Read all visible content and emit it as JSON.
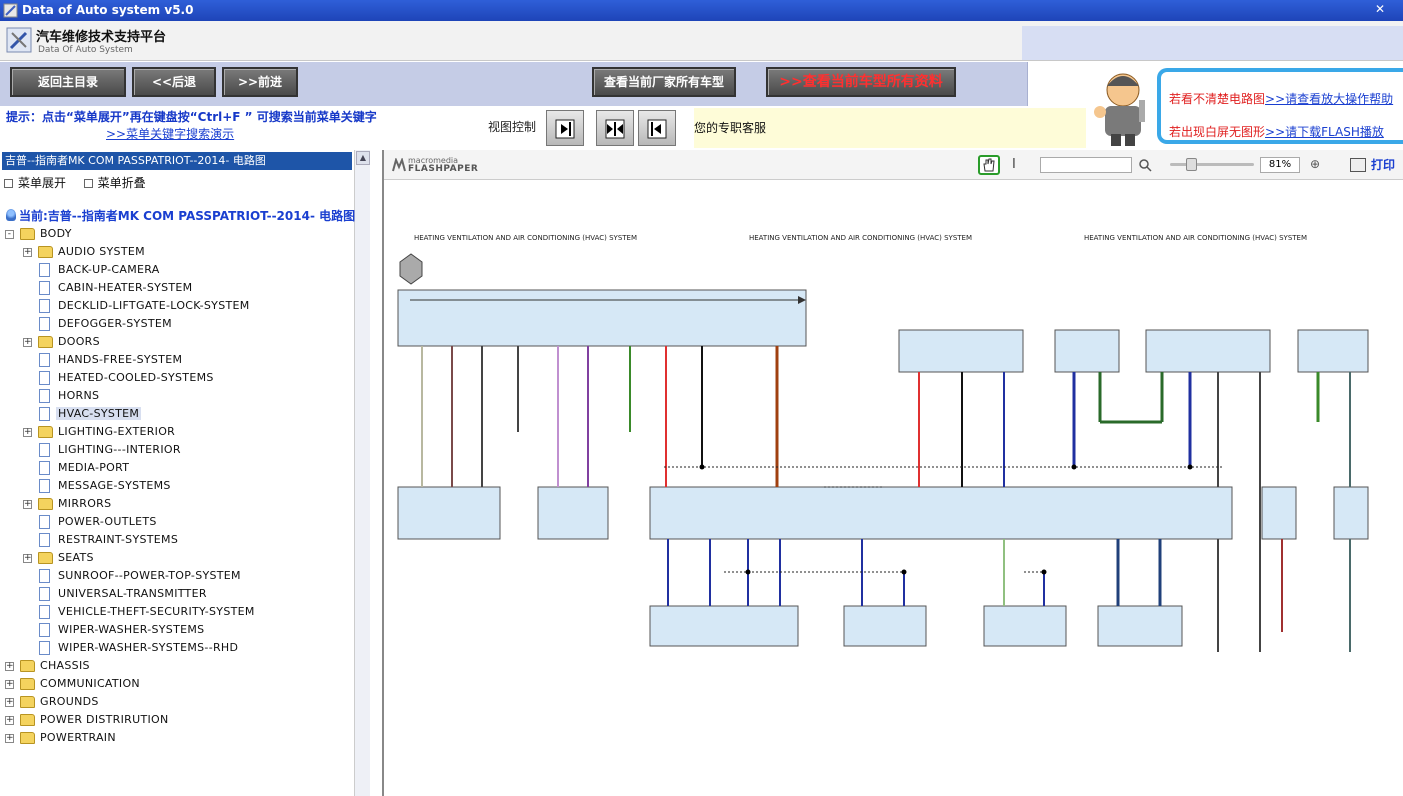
{
  "window": {
    "title": "Data of Auto system v5.0"
  },
  "header": {
    "title_cn": "汽车维修技术支持平台",
    "title_en": "Data Of Auto System"
  },
  "toolbar": {
    "home": "返回主目录",
    "back": "<<后退",
    "forward": ">>前进",
    "maker_models": "查看当前厂家所有车型",
    "all_data": ">>查看当前车型所有资料"
  },
  "promo": {
    "line1_red": "若看不清楚电路图",
    "line1_link": ">>请查看放大操作帮助",
    "line2_red": "若出现白屏无图形",
    "line2_link": ">>请下载FLASH播放"
  },
  "hint": {
    "text": "提示：点击“菜单展开”再在键盘按“Ctrl+F ” 可搜索当前菜单关键字",
    "link": ">>菜单关键字搜索演示"
  },
  "view_control": {
    "label": "视图控制"
  },
  "service": {
    "text": "您的专职客服"
  },
  "left": {
    "title": "吉普--指南者MK COM PASSPATRIOT--2014- 电路图",
    "expand": "菜单展开",
    "collapse": "菜单折叠",
    "current": "当前:吉普--指南者MK COM PASSPATRIOT--2014- 电路图"
  },
  "tree": [
    {
      "label": "BODY",
      "type": "folder",
      "level": 0,
      "toggle": "-"
    },
    {
      "label": "AUDIO SYSTEM",
      "type": "folder",
      "level": 1,
      "toggle": "+"
    },
    {
      "label": "BACK-UP-CAMERA",
      "type": "doc",
      "level": 1
    },
    {
      "label": "CABIN-HEATER-SYSTEM",
      "type": "doc",
      "level": 1
    },
    {
      "label": "DECKLID-LIFTGATE-LOCK-SYSTEM",
      "type": "doc",
      "level": 1
    },
    {
      "label": "DEFOGGER-SYSTEM",
      "type": "doc",
      "level": 1
    },
    {
      "label": "DOORS",
      "type": "folder",
      "level": 1,
      "toggle": "+"
    },
    {
      "label": "HANDS-FREE-SYSTEM",
      "type": "doc",
      "level": 1
    },
    {
      "label": "HEATED-COOLED-SYSTEMS",
      "type": "doc",
      "level": 1
    },
    {
      "label": "HORNS",
      "type": "doc",
      "level": 1
    },
    {
      "label": "HVAC-SYSTEM",
      "type": "doc",
      "level": 1,
      "selected": true
    },
    {
      "label": "LIGHTING-EXTERIOR",
      "type": "folder",
      "level": 1,
      "toggle": "+"
    },
    {
      "label": "LIGHTING---INTERIOR",
      "type": "doc",
      "level": 1
    },
    {
      "label": "MEDIA-PORT",
      "type": "doc",
      "level": 1
    },
    {
      "label": "MESSAGE-SYSTEMS",
      "type": "doc",
      "level": 1
    },
    {
      "label": "MIRRORS",
      "type": "folder",
      "level": 1,
      "toggle": "+"
    },
    {
      "label": "POWER-OUTLETS",
      "type": "doc",
      "level": 1
    },
    {
      "label": "RESTRAINT-SYSTEMS",
      "type": "doc",
      "level": 1
    },
    {
      "label": "SEATS",
      "type": "folder",
      "level": 1,
      "toggle": "+"
    },
    {
      "label": "SUNROOF--POWER-TOP-SYSTEM",
      "type": "doc",
      "level": 1
    },
    {
      "label": "UNIVERSAL-TRANSMITTER",
      "type": "doc",
      "level": 1
    },
    {
      "label": "VEHICLE-THEFT-SECURITY-SYSTEM",
      "type": "doc",
      "level": 1
    },
    {
      "label": "WIPER-WASHER-SYSTEMS",
      "type": "doc",
      "level": 1
    },
    {
      "label": "WIPER-WASHER-SYSTEMS--RHD",
      "type": "doc",
      "level": 1
    },
    {
      "label": "CHASSIS",
      "type": "folder",
      "level": 0,
      "toggle": "+"
    },
    {
      "label": "COMMUNICATION",
      "type": "folder",
      "level": 0,
      "toggle": "+"
    },
    {
      "label": "GROUNDS",
      "type": "folder",
      "level": 0,
      "toggle": "+"
    },
    {
      "label": "POWER DISTRIRUTION",
      "type": "folder",
      "level": 0,
      "toggle": "+"
    },
    {
      "label": "POWERTRAIN",
      "type": "folder",
      "level": 0,
      "toggle": "+"
    }
  ],
  "viewer": {
    "brand_top": "macromedia",
    "brand_bottom": "FLASHPAPER",
    "zoom": "81%",
    "print": "打印",
    "diagram_titles": [
      "HEATING VENTILATION AND AIR CONDITIONING (HVAC) SYSTEM",
      "HEATING VENTILATION AND AIR CONDITIONING (HVAC) SYSTEM",
      "HEATING VENTILATION AND AIR CONDITIONING (HVAC) SYSTEM"
    ]
  },
  "colors": {
    "titlebar": "#2f5fd8",
    "toolbar": "#c5cce6",
    "module_fill": "#d6e8f6",
    "link_blue": "#1a3fd0",
    "alert_red": "#e02020"
  }
}
